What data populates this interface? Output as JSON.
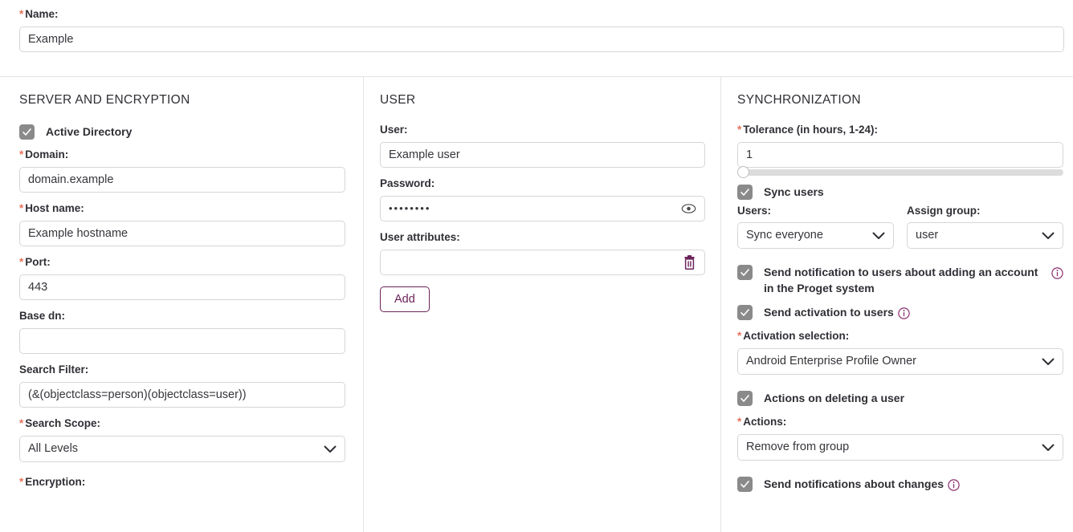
{
  "form": {
    "name_field": {
      "label": "Name:",
      "required": true,
      "value": "Example"
    }
  },
  "server_section": {
    "title": "SERVER AND ENCRYPTION",
    "active_directory": {
      "label": "Active Directory",
      "checked": true
    },
    "domain": {
      "label": "Domain:",
      "value": "domain.example"
    },
    "host_name": {
      "label": "Host name:",
      "value": "Example hostname"
    },
    "port": {
      "label": "Port:",
      "value": "443"
    },
    "base_dn": {
      "label": "Base dn:",
      "value": ""
    },
    "search_filter": {
      "label": "Search Filter:",
      "value": "(&(objectclass=person)(objectclass=user))"
    },
    "search_scope": {
      "label": "Search Scope:",
      "value": "All Levels"
    },
    "encryption": {
      "label": "Encryption:"
    }
  },
  "user_section": {
    "title": "USER",
    "user": {
      "label": "User:",
      "value": "Example user"
    },
    "password": {
      "label": "Password:",
      "value": "••••••••"
    },
    "user_attributes": {
      "label": "User attributes:",
      "value": ""
    },
    "add_button": "Add"
  },
  "sync_section": {
    "title": "SYNCHRONIZATION",
    "tolerance": {
      "label": "Tolerance (in hours, 1-24):",
      "value": "1",
      "min": 1,
      "max": 24
    },
    "sync_users": {
      "label": "Sync users",
      "checked": true
    },
    "users": {
      "label": "Users:",
      "value": "Sync everyone"
    },
    "assign_group": {
      "label": "Assign group:",
      "value": "user"
    },
    "send_notification_account": {
      "label": "Send notification to users about adding an account in the Proget system",
      "checked": true
    },
    "send_activation": {
      "label": "Send activation to users",
      "checked": true
    },
    "activation_selection": {
      "label": "Activation selection:",
      "value": "Android Enterprise Profile Owner"
    },
    "actions_on_deleting": {
      "label": "Actions on deleting a user",
      "checked": true
    },
    "actions": {
      "label": "Actions:",
      "value": "Remove from group"
    },
    "send_notifications_changes": {
      "label": "Send notifications about changes",
      "checked": true
    }
  },
  "icons": {
    "eye": "eye-icon",
    "trash": "trash-icon",
    "info": "info-icon",
    "chevron_down": "chevron-down-icon",
    "check": "check-icon"
  },
  "colors": {
    "accent_purple": "#6b2259",
    "required_star": "#e8705a",
    "checkbox_fill": "#8a8a8a",
    "border": "#d6d6d6",
    "divider": "#e3e3e3",
    "text": "#2f2f35"
  }
}
